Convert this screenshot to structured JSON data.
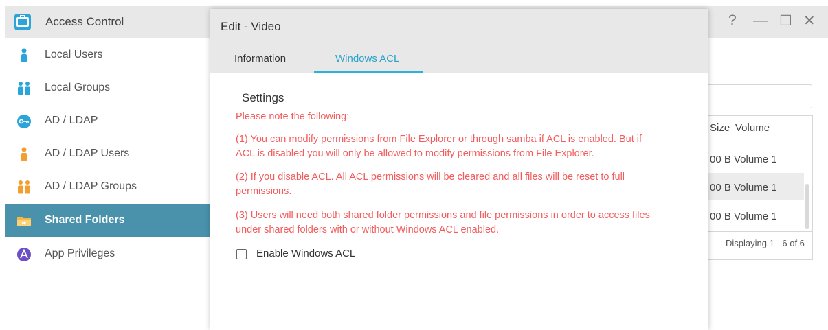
{
  "app": {
    "title": "Access Control"
  },
  "window_controls": {
    "help": "?",
    "minimize": "—",
    "maximize": "☐",
    "close": "✕"
  },
  "sidebar": {
    "items": [
      {
        "label": "Local Users",
        "icon": "user-icon",
        "color": "#2aa4d9"
      },
      {
        "label": "Local Groups",
        "icon": "group-icon",
        "color": "#2aa4d9"
      },
      {
        "label": "AD / LDAP",
        "icon": "key-icon",
        "color": "#2aa4d9"
      },
      {
        "label": "AD / LDAP Users",
        "icon": "user-icon",
        "color": "#f0a030"
      },
      {
        "label": "AD / LDAP Groups",
        "icon": "group-icon",
        "color": "#f0a030"
      },
      {
        "label": "Shared Folders",
        "icon": "folder-icon",
        "color": "#f5b942",
        "active": true
      },
      {
        "label": "App Privileges",
        "icon": "app-icon",
        "color": "#6c4fc4"
      }
    ]
  },
  "background_table": {
    "headers": [
      "Size",
      "Volume"
    ],
    "rows": [
      {
        "size": "00 B",
        "volume": "Volume 1"
      },
      {
        "size": "00 B",
        "volume": "Volume 1"
      },
      {
        "size": "00 B",
        "volume": "Volume 1"
      }
    ],
    "footer": "Displaying 1 - 6 of 6"
  },
  "dialog": {
    "title": "Edit - Video",
    "tabs": [
      {
        "label": "Information",
        "active": false
      },
      {
        "label": "Windows ACL",
        "active": true
      }
    ],
    "settings": {
      "legend": "Settings",
      "note_heading": "Please note the following:",
      "notes": [
        [
          "(1) You can modify permissions from File Explorer or through samba if ACL is enabled. But if",
          "ACL is disabled you will only be allowed to modify permissions from File Explorer."
        ],
        [
          "(2) If you disable ACL. All ACL permissions will be cleared and all files will be reset to full",
          "permissions."
        ],
        [
          "(3) Users will need both shared folder permissions and file permissions in order to access files",
          "under shared folders with or without Windows ACL enabled."
        ]
      ],
      "checkbox_label": "Enable Windows ACL",
      "checkbox_checked": false
    }
  },
  "colors": {
    "accent": "#2fb0d6",
    "active_sidebar": "#4a92ac",
    "warning": "#f35c5c"
  }
}
